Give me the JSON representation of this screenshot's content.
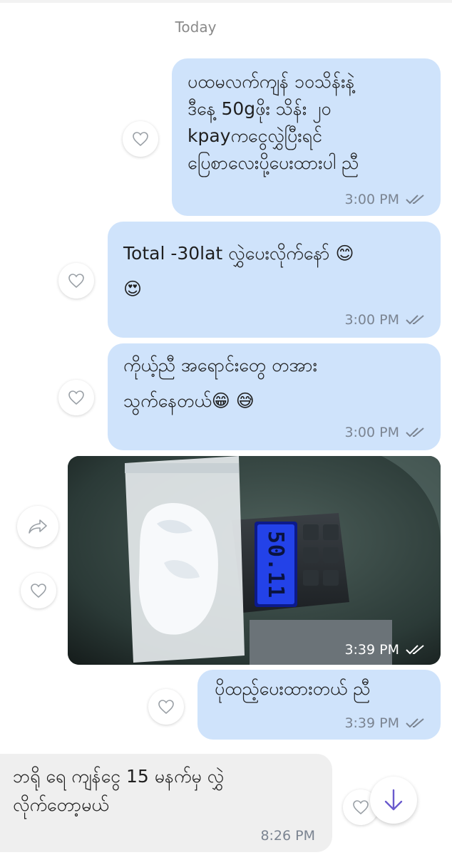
{
  "date_separator": "Today",
  "messages": [
    {
      "direction": "outgoing",
      "text": "ပထမလက်ကျန် ၁၀သိန်းနဲ့\nဒီနေ့ 50gဖိုး သိန်း ၂၀\nkpayကငွေလွှဲပြီးရင်\nပြေစာလေးပို့ပေးထားပါ ညီ",
      "time": "3:00 PM"
    },
    {
      "direction": "outgoing",
      "text_line1": "Total -30lat လွှဲပေးလိုက်နော် ",
      "emoji_1": "😊",
      "emoji_2": "😍",
      "time": "3:00 PM"
    },
    {
      "direction": "outgoing",
      "text_line1": "ကိုယ့်ညီ အရောင်းတွေ တအား",
      "text_line2": "သွက်နေတယ်",
      "emoji_1": "😁",
      "emoji_2": "😅",
      "time": "3:00 PM"
    },
    {
      "direction": "outgoing",
      "type": "photo",
      "photo_content": {
        "scale_reading": "50.11"
      },
      "time": "3:39 PM"
    },
    {
      "direction": "outgoing",
      "text": "ပိုထည့်ပေးထားတယ် ညီ",
      "time": "3:39 PM"
    },
    {
      "direction": "incoming",
      "text": "ဘရို ရေ ကျန်ငွေ 15 မနက်မှ လွှဲ\nလိုက်တော့မယ်",
      "time": "8:26 PM"
    }
  ],
  "colors": {
    "outgoing_bubble": "#cfe3fb",
    "incoming_bubble": "#efefef",
    "meta_text": "#7b8491",
    "scroll_arrow": "#6a5acd"
  },
  "icons": {
    "reaction": "heart-outline-icon",
    "share": "share-arrow-icon",
    "read_status": "double-check-icon",
    "scroll": "arrow-down-icon"
  }
}
